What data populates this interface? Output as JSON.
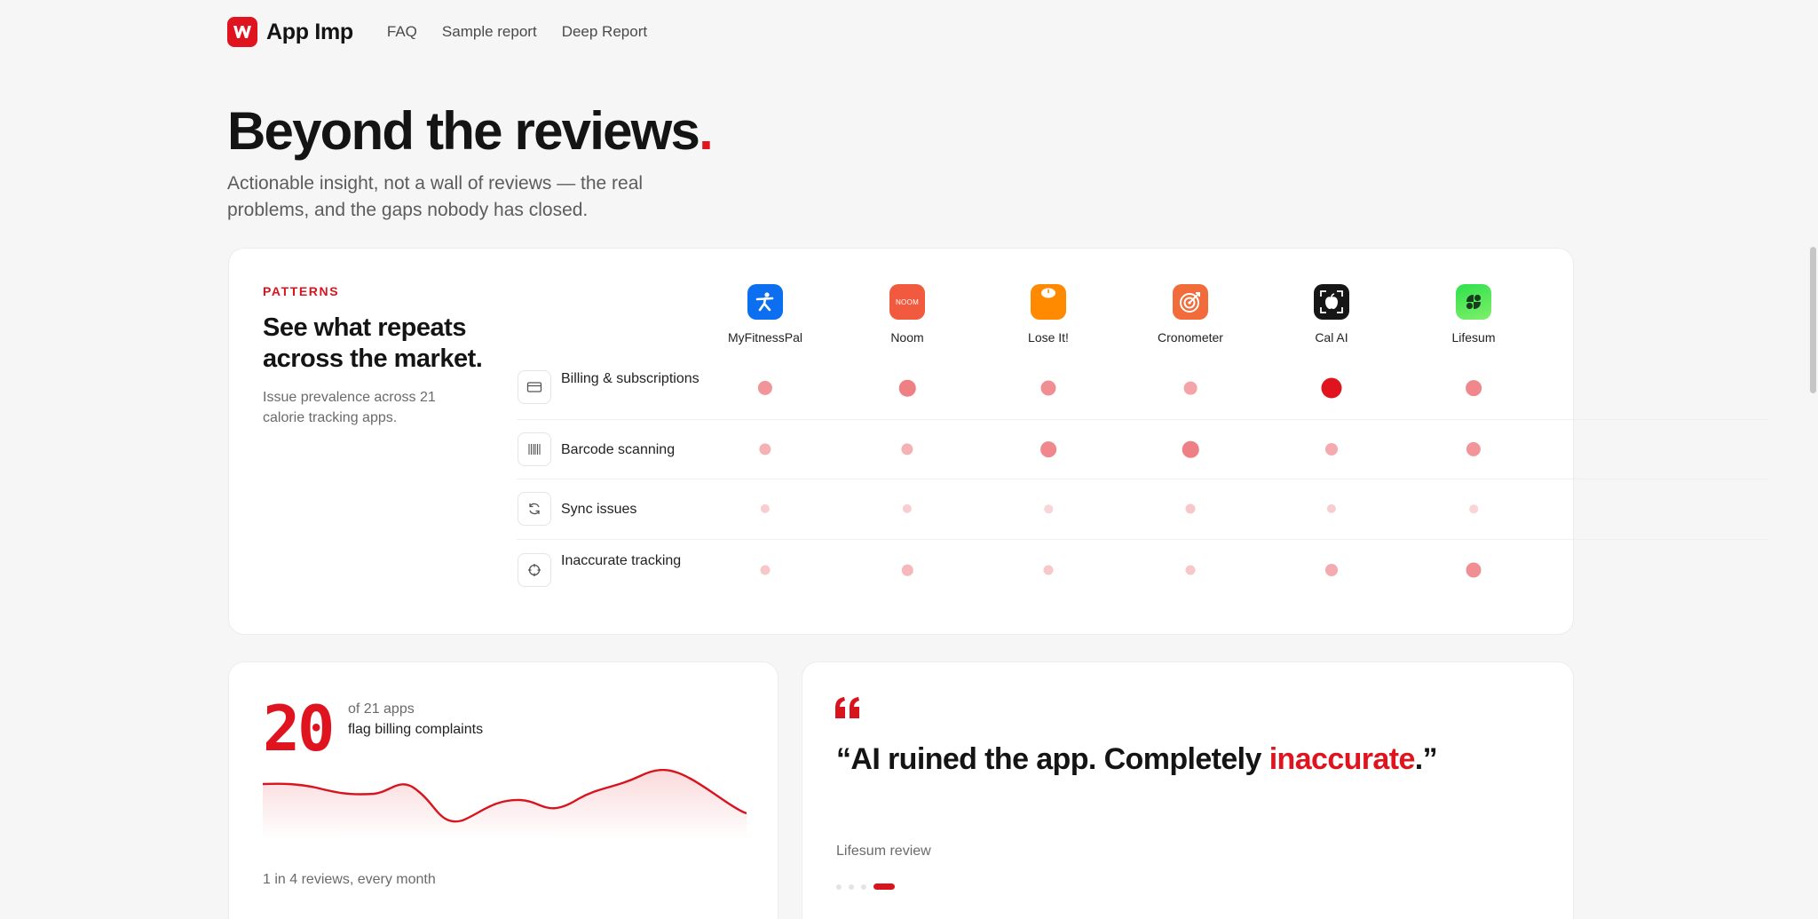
{
  "nav": {
    "brand": "App Imp",
    "links": [
      "FAQ",
      "Sample report",
      "Deep Report"
    ]
  },
  "hero": {
    "title": "Beyond the reviews",
    "title_dot": ".",
    "subtitle": "Actionable insight, not a wall of reviews — the real problems, and the gaps nobody has closed."
  },
  "patterns": {
    "eyebrow": "PATTERNS",
    "title": "See what repeats across the market.",
    "description": "Issue prevalence across 21 calorie tracking apps.",
    "apps": [
      {
        "name": "MyFitnessPal",
        "color": "#0b6ff0",
        "icon": "runner-icon"
      },
      {
        "name": "Noom",
        "color": "#f25a3f",
        "icon": "noom-wordmark",
        "mark": "NOOM"
      },
      {
        "name": "Lose It!",
        "color": "#ff8a00",
        "icon": "scale-icon"
      },
      {
        "name": "Cronometer",
        "color": "#f26b3a",
        "icon": "target-icon"
      },
      {
        "name": "Cal AI",
        "color": "#161616",
        "icon": "apple-icon"
      },
      {
        "name": "Lifesum",
        "color": "#2fd94a",
        "icon": "leaf-icon"
      }
    ],
    "issues": [
      {
        "label": "Billing & subscriptions",
        "icon": "card-icon",
        "levels": [
          0.55,
          0.7,
          0.6,
          0.45,
          1.0,
          0.65
        ]
      },
      {
        "label": "Barcode scanning",
        "icon": "barcode-icon",
        "levels": [
          0.35,
          0.35,
          0.65,
          0.7,
          0.4,
          0.55
        ]
      },
      {
        "label": "Sync issues",
        "icon": "sync-icon",
        "levels": [
          0.15,
          0.15,
          0.1,
          0.2,
          0.15,
          0.1
        ]
      },
      {
        "label": "Inaccurate tracking",
        "icon": "crosshair-icon",
        "levels": [
          0.2,
          0.3,
          0.2,
          0.2,
          0.4,
          0.6
        ]
      }
    ]
  },
  "stat": {
    "number": "20",
    "of_label": "of 21 apps",
    "flag_label": "flag billing complaints",
    "footnote": "1 in 4 reviews, every month"
  },
  "quote": {
    "open": "“AI ruined the app. Completely ",
    "highlight": "inaccurate",
    "close": ".”",
    "source": "Lifesum review",
    "pages": 4,
    "active_page": 4
  },
  "colors": {
    "accent": "#e0141e",
    "text": "#141414",
    "muted": "#6a6a6a",
    "background": "#f6f6f6"
  }
}
